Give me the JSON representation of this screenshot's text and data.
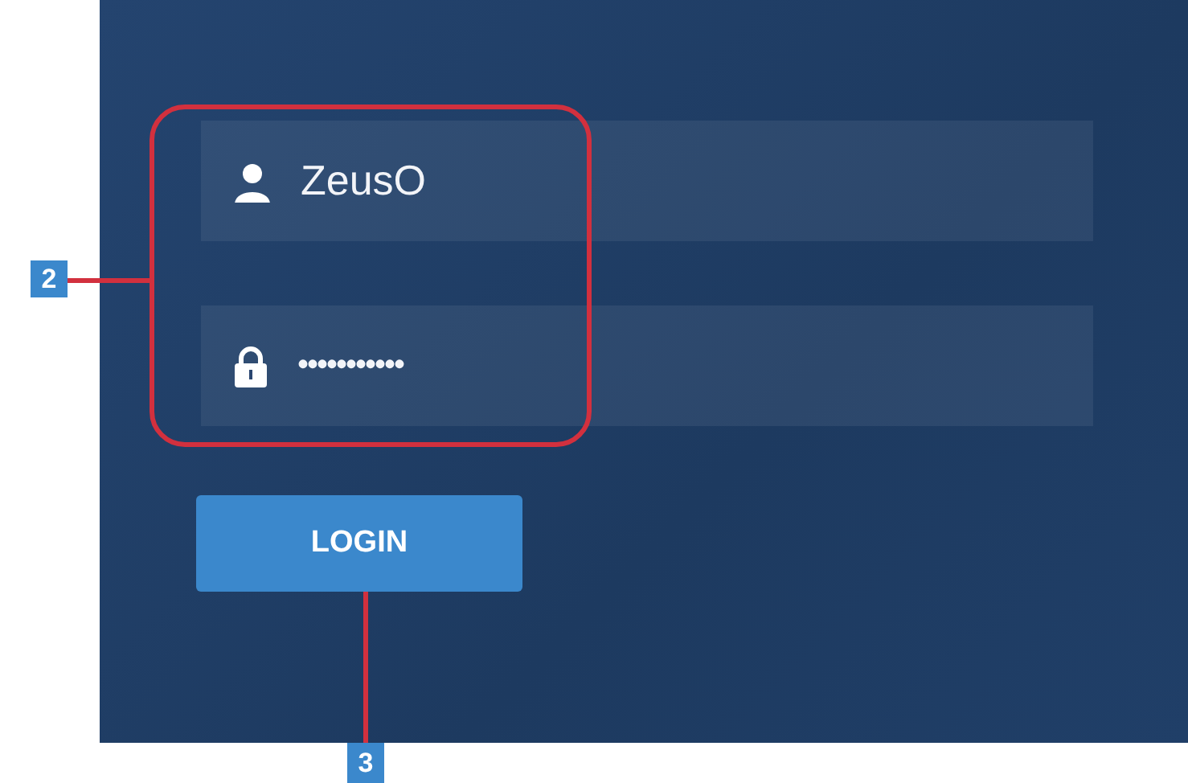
{
  "login_form": {
    "username": {
      "value": "ZeusO"
    },
    "password": {
      "value": "•••••••••••"
    },
    "login_button": {
      "label": "LOGIN"
    }
  },
  "callouts": [
    {
      "label": "2"
    },
    {
      "label": "3"
    }
  ]
}
